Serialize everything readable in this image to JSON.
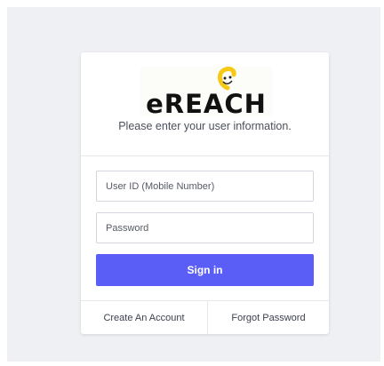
{
  "login": {
    "logo_text": "eREACH",
    "subtitle": "Please enter your user information.",
    "user_id_placeholder": "User ID (Mobile Number)",
    "password_placeholder": "Password",
    "sign_in_label": "Sign in",
    "create_account_label": "Create An Account",
    "forgot_password_label": "Forgot Password"
  },
  "colors": {
    "background": "#eff0f4",
    "primary_button": "#5b5ef6",
    "logo_text": "#111111",
    "logo_mascot": "#f6c914"
  }
}
